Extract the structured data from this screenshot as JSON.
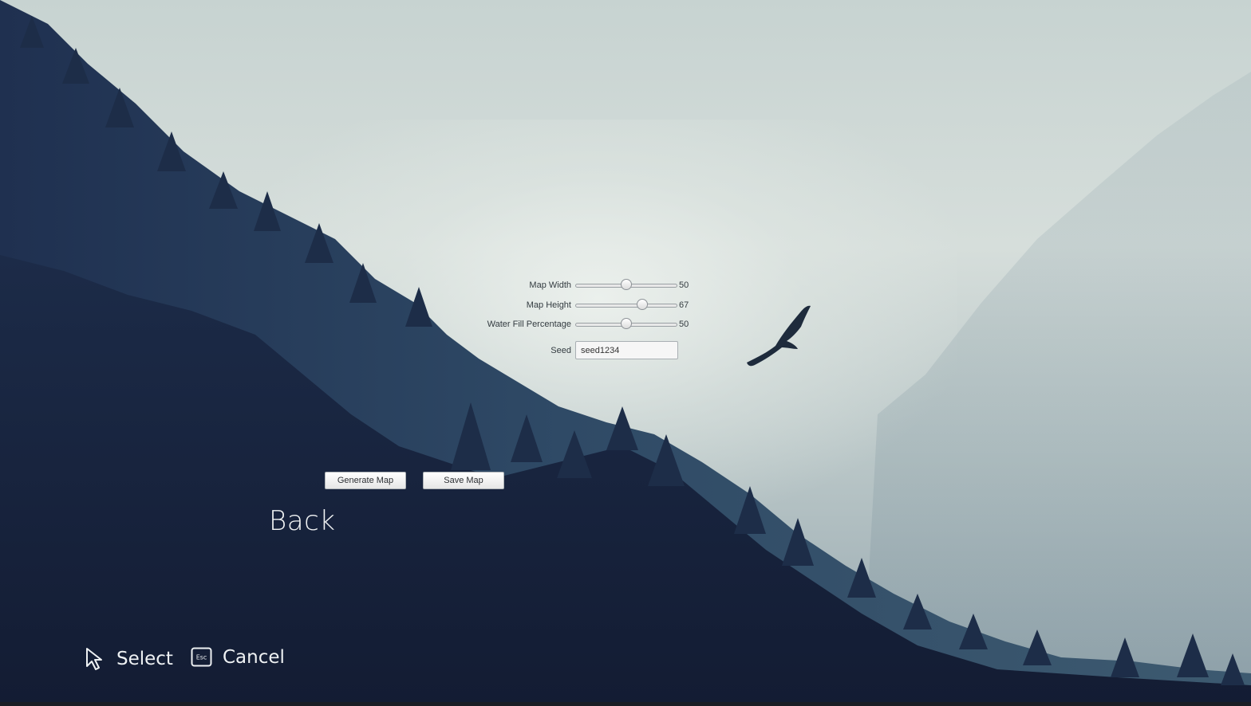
{
  "settings": {
    "map_width": {
      "label": "Map Width",
      "value": 50,
      "fraction": 0.5
    },
    "map_height": {
      "label": "Map Height",
      "value": 67,
      "fraction": 0.66
    },
    "water_fill": {
      "label": "Water Fill Percentage",
      "value": 50,
      "fraction": 0.5
    },
    "seed": {
      "label": "Seed",
      "value": "seed1234"
    }
  },
  "buttons": {
    "generate": "Generate Map",
    "save": "Save Map"
  },
  "menu": {
    "back": "Back"
  },
  "hints": {
    "select": {
      "icon": "mouse-cursor-icon",
      "label": "Select"
    },
    "cancel": {
      "icon": "esc-key-icon",
      "key": "Esc",
      "label": "Cancel"
    }
  }
}
